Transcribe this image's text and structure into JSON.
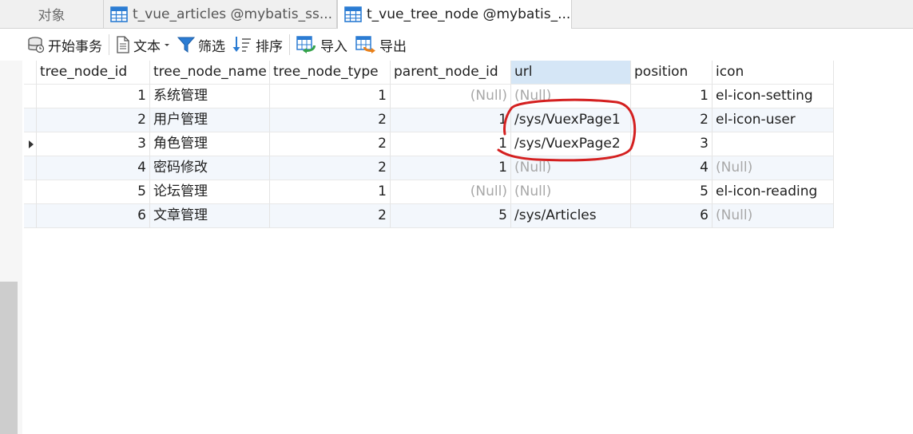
{
  "tabs": [
    {
      "label": "对象"
    },
    {
      "label": "t_vue_articles @mybatis_ss..."
    },
    {
      "label": "t_vue_tree_node @mybatis_..."
    }
  ],
  "toolbar": {
    "begin_transaction": "开始事务",
    "text": "文本",
    "filter": "筛选",
    "sort": "排序",
    "import": "导入",
    "export": "导出"
  },
  "table": {
    "columns": [
      "tree_node_id",
      "tree_node_name",
      "tree_node_type",
      "parent_node_id",
      "url",
      "position",
      "icon"
    ],
    "rows": [
      [
        "1",
        "系统管理",
        "1",
        "(Null)",
        "(Null)",
        "1",
        "el-icon-setting"
      ],
      [
        "2",
        "用户管理",
        "2",
        "1",
        "/sys/VuexPage1",
        "2",
        "el-icon-user"
      ],
      [
        "3",
        "角色管理",
        "2",
        "1",
        "/sys/VuexPage2",
        "3",
        ""
      ],
      [
        "4",
        "密码修改",
        "2",
        "1",
        "(Null)",
        "4",
        "(Null)"
      ],
      [
        "5",
        "论坛管理",
        "1",
        "(Null)",
        "(Null)",
        "5",
        "el-icon-reading"
      ],
      [
        "6",
        "文章管理",
        "2",
        "5",
        "/sys/Articles",
        "6",
        "(Null)"
      ]
    ],
    "current_row": 3,
    "selected_column": "url"
  },
  "colors": {
    "accent": "#2b7cd3",
    "annotation": "#d42020",
    "null_text": "#a8a8a8"
  }
}
